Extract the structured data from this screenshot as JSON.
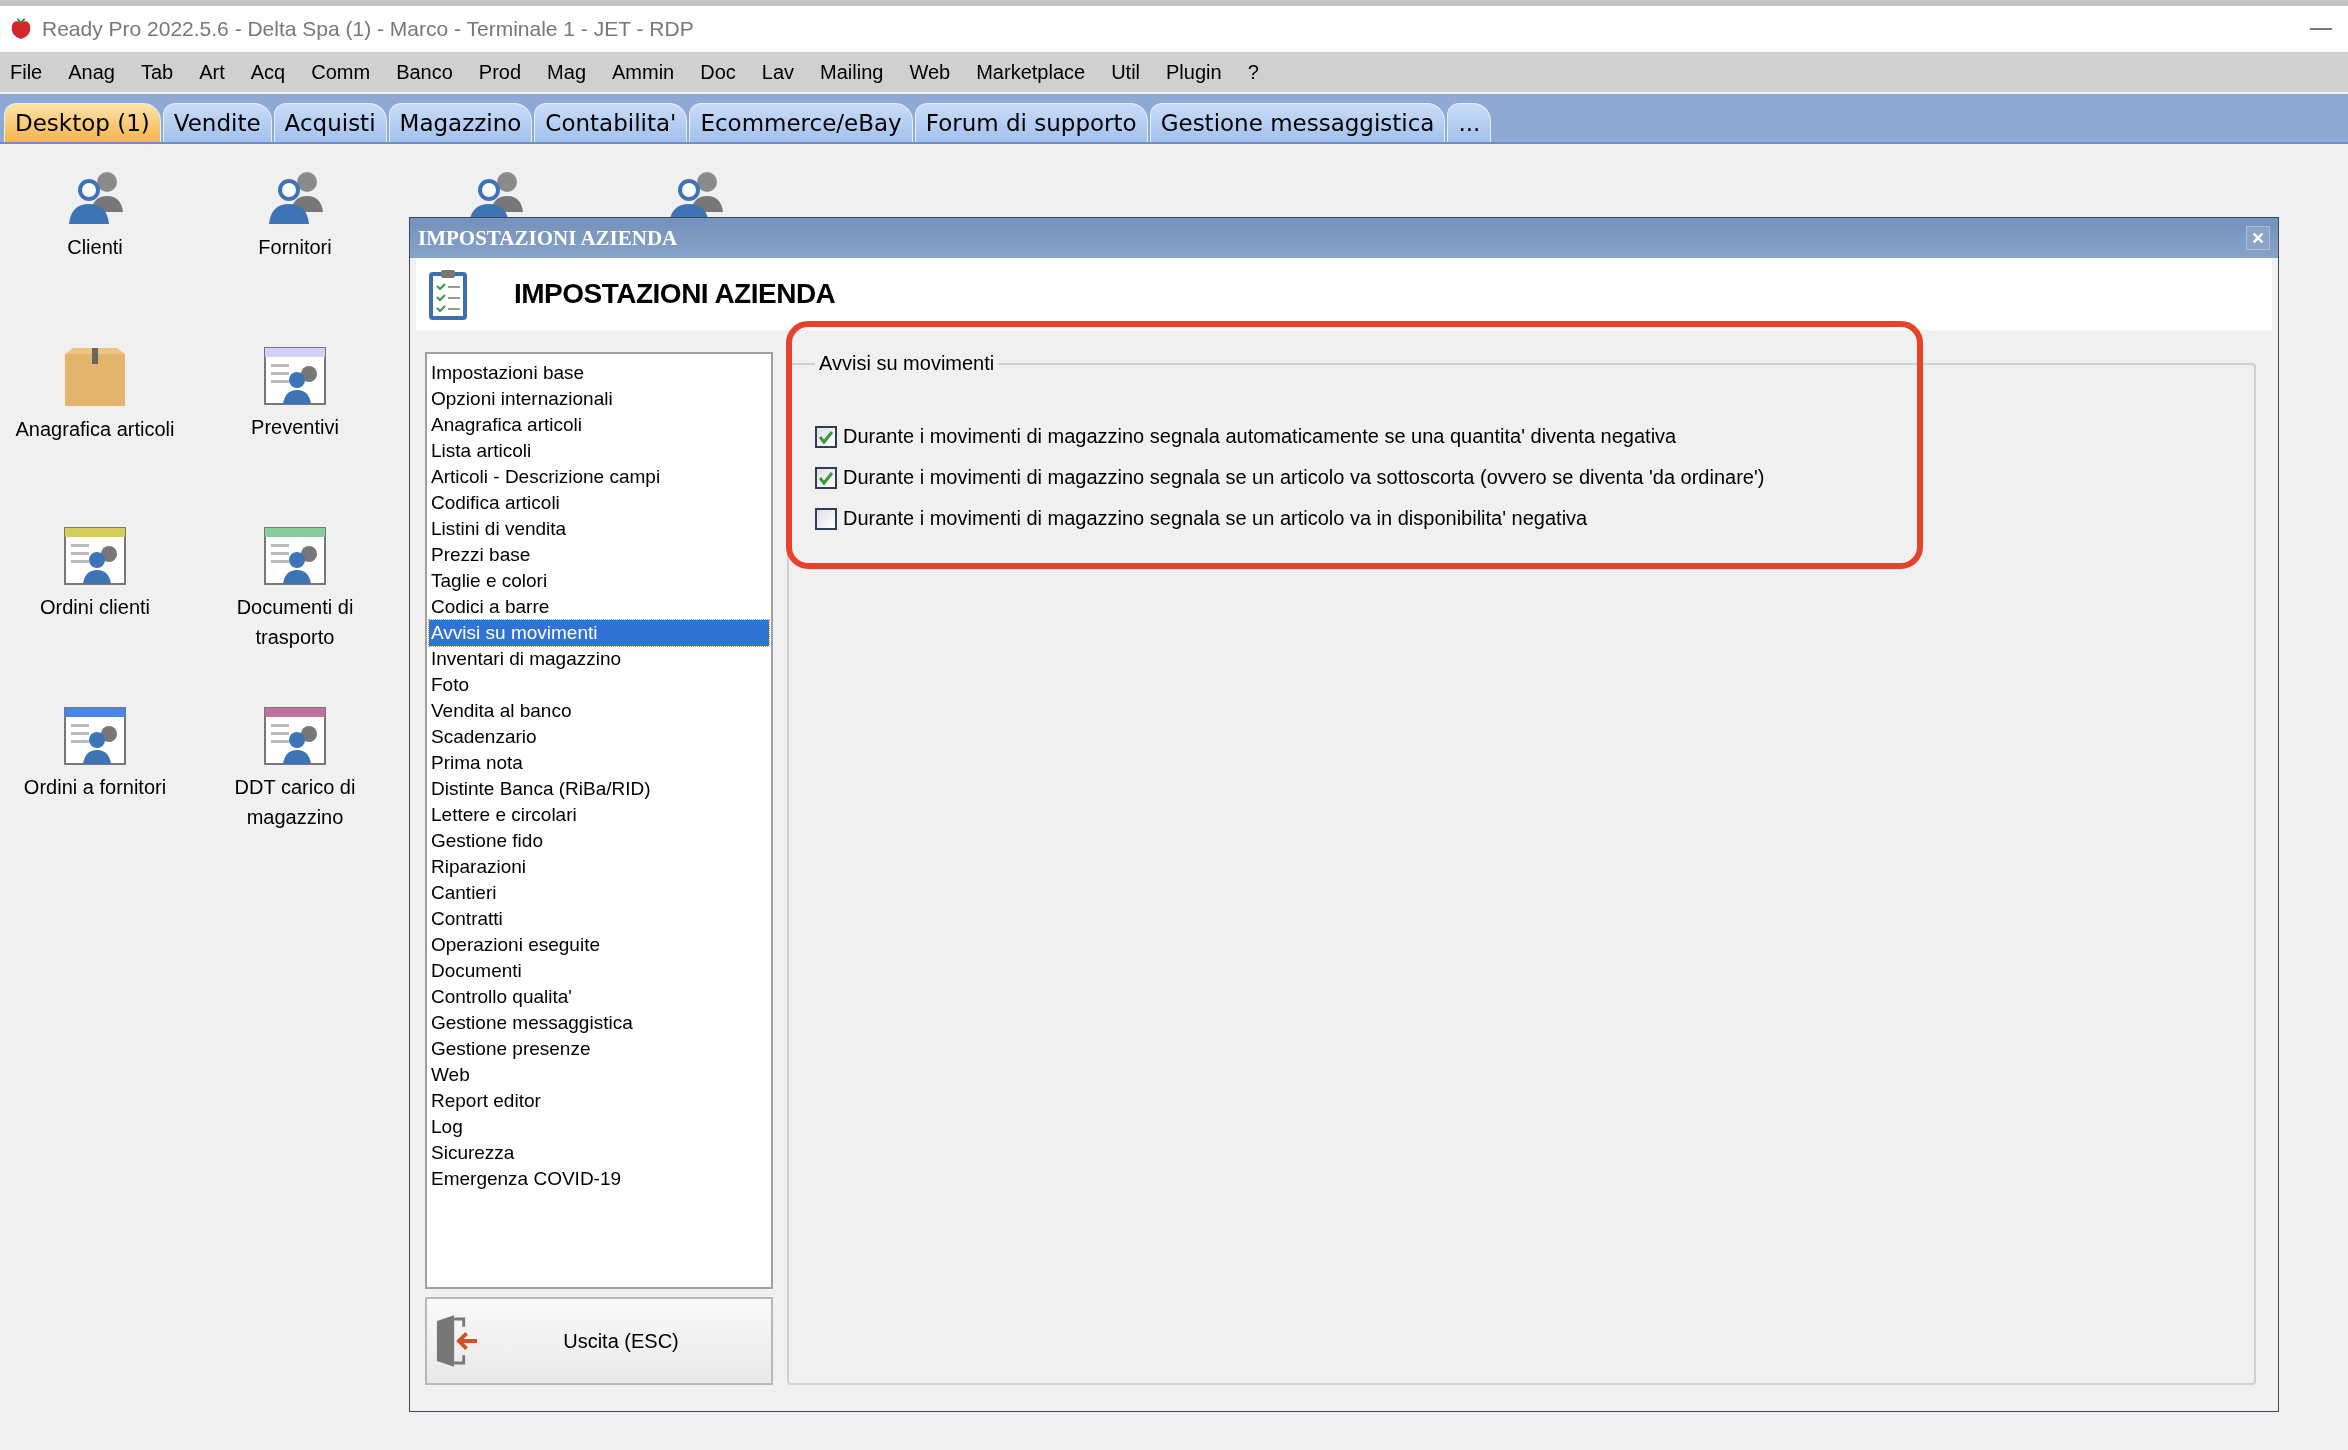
{
  "window": {
    "title": "Ready Pro 2022.5.6 - Delta Spa (1) - Marco - Terminale 1 - JET - RDP"
  },
  "menu": [
    "File",
    "Anag",
    "Tab",
    "Art",
    "Acq",
    "Comm",
    "Banco",
    "Prod",
    "Mag",
    "Ammin",
    "Doc",
    "Lav",
    "Mailing",
    "Web",
    "Marketplace",
    "Util",
    "Plugin",
    "?"
  ],
  "tabs": [
    {
      "label": "Desktop (1)",
      "selected": true
    },
    {
      "label": "Vendite",
      "selected": false
    },
    {
      "label": "Acquisti",
      "selected": false
    },
    {
      "label": "Magazzino",
      "selected": false
    },
    {
      "label": "Contabilita'",
      "selected": false
    },
    {
      "label": "Ecommerce/eBay",
      "selected": false
    },
    {
      "label": "Forum di supporto",
      "selected": false
    },
    {
      "label": "Gestione messaggistica",
      "selected": false
    },
    {
      "label": "...",
      "selected": false
    }
  ],
  "desktop_icons": [
    {
      "label": "Clienti",
      "kind": "people"
    },
    {
      "label": "Fornitori",
      "kind": "people"
    },
    {
      "label": "Anagrafica articoli",
      "kind": "box"
    },
    {
      "label": "Preventivi",
      "kind": "document",
      "color": "#d0d0f8"
    },
    {
      "label": "Ordini clienti",
      "kind": "document",
      "color": "#d4cc5a"
    },
    {
      "label": "Documenti di trasporto",
      "kind": "document",
      "color": "#88cc99"
    },
    {
      "label": "Ordini a fornitori",
      "kind": "document",
      "color": "#4a86e8"
    },
    {
      "label": "DDT carico di magazzino",
      "kind": "document",
      "color": "#c0709c"
    }
  ],
  "covered_icons": [
    {
      "kind": "people"
    },
    {
      "kind": "people"
    }
  ],
  "dialog": {
    "title": "IMPOSTAZIONI AZIENDA",
    "heading": "IMPOSTAZIONI AZIENDA",
    "nav": [
      {
        "label": "Impostazioni base",
        "selected": false
      },
      {
        "label": "Opzioni internazionali",
        "selected": false
      },
      {
        "label": "Anagrafica articoli",
        "selected": false
      },
      {
        "label": "Lista articoli",
        "selected": false
      },
      {
        "label": "Articoli - Descrizione campi",
        "selected": false
      },
      {
        "label": "Codifica articoli",
        "selected": false
      },
      {
        "label": "Listini di vendita",
        "selected": false
      },
      {
        "label": "Prezzi base",
        "selected": false
      },
      {
        "label": "Taglie e colori",
        "selected": false
      },
      {
        "label": "Codici a barre",
        "selected": false
      },
      {
        "label": "Avvisi su movimenti",
        "selected": true
      },
      {
        "label": "Inventari di magazzino",
        "selected": false
      },
      {
        "label": "Foto",
        "selected": false
      },
      {
        "label": "Vendita al banco",
        "selected": false
      },
      {
        "label": "Scadenzario",
        "selected": false
      },
      {
        "label": "Prima nota",
        "selected": false
      },
      {
        "label": "Distinte Banca (RiBa/RID)",
        "selected": false
      },
      {
        "label": "Lettere e circolari",
        "selected": false
      },
      {
        "label": "Gestione fido",
        "selected": false
      },
      {
        "label": "Riparazioni",
        "selected": false
      },
      {
        "label": "Cantieri",
        "selected": false
      },
      {
        "label": "Contratti",
        "selected": false
      },
      {
        "label": "Operazioni eseguite",
        "selected": false
      },
      {
        "label": "Documenti",
        "selected": false
      },
      {
        "label": "Controllo qualita'",
        "selected": false
      },
      {
        "label": "Gestione messaggistica",
        "selected": false
      },
      {
        "label": "Gestione presenze",
        "selected": false
      },
      {
        "label": "Web",
        "selected": false
      },
      {
        "label": "Report editor",
        "selected": false
      },
      {
        "label": "Log",
        "selected": false
      },
      {
        "label": "Sicurezza",
        "selected": false
      },
      {
        "label": "Emergenza COVID-19",
        "selected": false
      }
    ],
    "exit_button": "Uscita (ESC)",
    "group": {
      "legend": "Avvisi su movimenti",
      "options": [
        {
          "label": "Durante i movimenti di magazzino segnala automaticamente se una quantita' diventa negativa",
          "checked": true
        },
        {
          "label": "Durante i movimenti di magazzino segnala se un articolo va sottoscorta (ovvero se diventa 'da ordinare')",
          "checked": true
        },
        {
          "label": "Durante i movimenti di magazzino segnala se un articolo va in disponibilita' negativa",
          "checked": false
        }
      ]
    }
  }
}
